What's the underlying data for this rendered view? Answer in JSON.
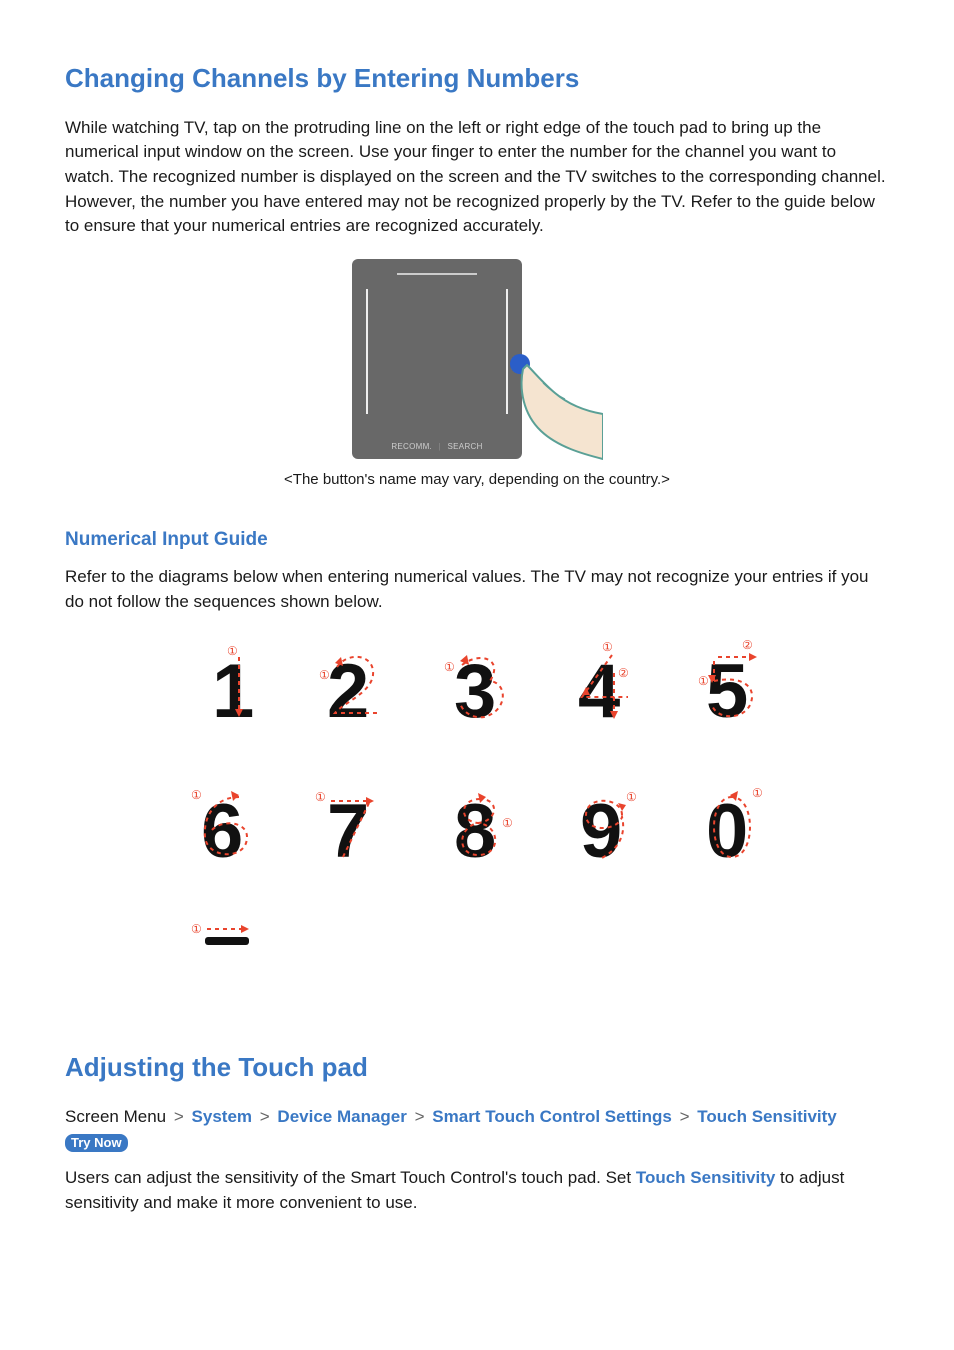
{
  "section1": {
    "heading": "Changing Channels by Entering Numbers",
    "body": "While watching TV, tap on the protruding line on the left or right edge of the touch pad to bring up the numerical input window on the screen. Use your finger to enter the number for the channel you want to watch. The recognized number is displayed on the screen and the TV switches to the corresponding channel. However, the number you have entered may not be recognized properly by the TV. Refer to the guide below to ensure that your numerical entries are recognized accurately."
  },
  "touchpad": {
    "bottom_labels": [
      "RECOMM.",
      "SEARCH"
    ],
    "caption": "<The button's name may vary, depending on the country.>"
  },
  "section2": {
    "heading": "Numerical Input Guide",
    "body": "Refer to the diagrams below when entering numerical values. The TV may not recognize your entries if you do not follow the sequences shown below."
  },
  "digits": {
    "row1": [
      "1",
      "2",
      "3",
      "4",
      "5"
    ],
    "row2": [
      "6",
      "7",
      "8",
      "9",
      "0"
    ],
    "step1": "①",
    "step2": "②"
  },
  "section3": {
    "heading": "Adjusting the Touch pad",
    "breadcrumb": {
      "prefix": "Screen Menu",
      "items": [
        "System",
        "Device Manager",
        "Smart Touch Control Settings",
        "Touch Sensitivity"
      ],
      "try_now": "Try Now"
    },
    "body_pre": "Users can adjust the sensitivity of the Smart Touch Control's touch pad. Set ",
    "body_term": "Touch Sensitivity",
    "body_post": " to adjust sensitivity and make it more convenient to use."
  }
}
